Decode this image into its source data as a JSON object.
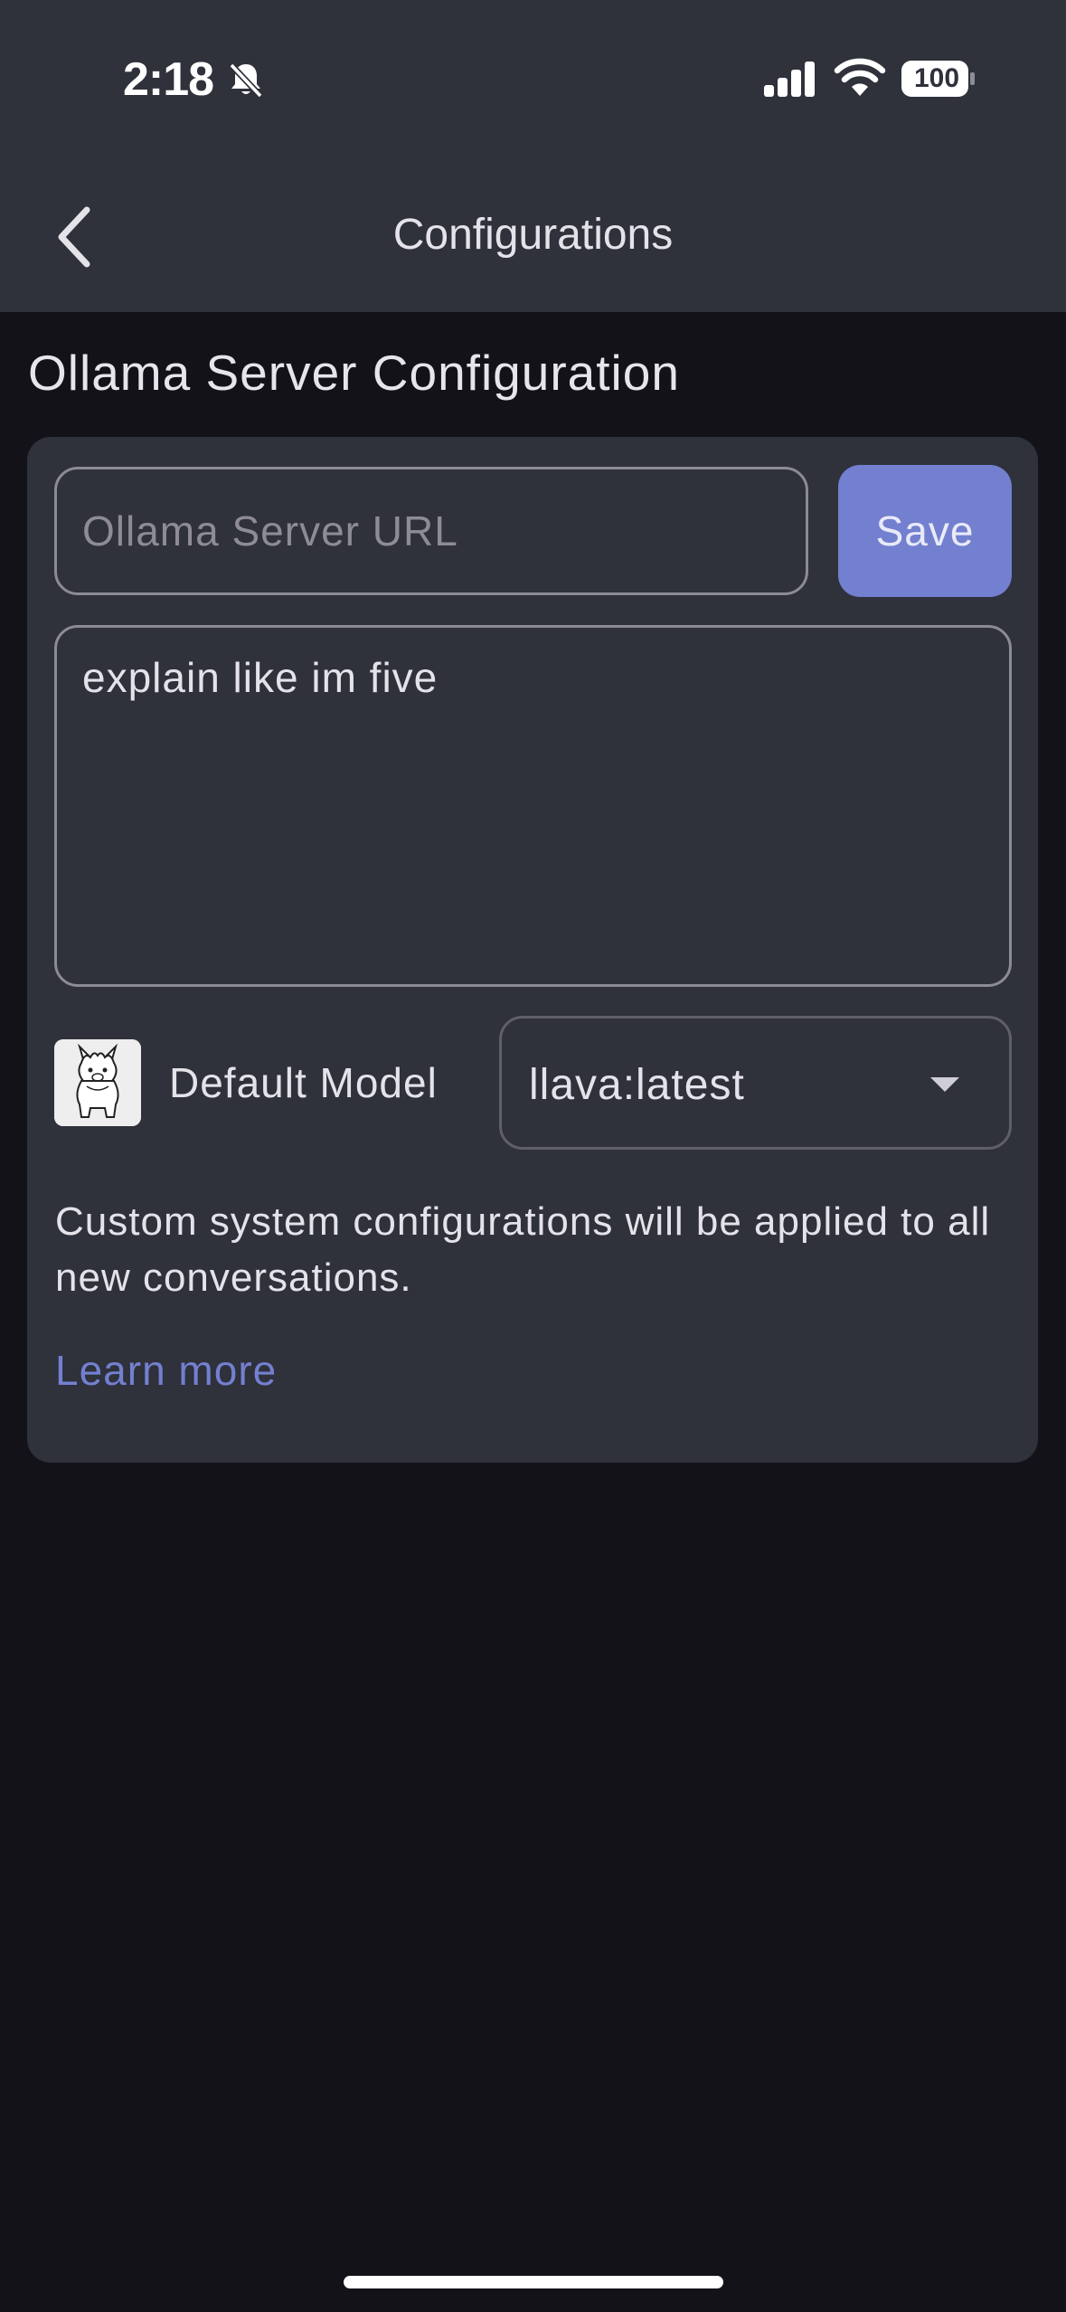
{
  "status_bar": {
    "time": "2:18",
    "battery": "100",
    "icons": [
      "bell-slash-icon",
      "cellular-signal-icon",
      "wifi-icon",
      "battery-icon"
    ]
  },
  "nav": {
    "title": "Configurations",
    "back_icon": "chevron-left-icon"
  },
  "section": {
    "title": "Ollama Server Configuration"
  },
  "server": {
    "url_value": "",
    "url_placeholder": "Ollama Server URL",
    "save_label": "Save"
  },
  "system_prompt": {
    "value": "explain like im five"
  },
  "model": {
    "label": "Default Model",
    "selected": "llava:latest",
    "avatar_icon": "llama-avatar-icon"
  },
  "info": {
    "text": "Custom system configurations will be applied to all new conversations.",
    "link": "Learn more"
  },
  "colors": {
    "background": "#131218",
    "surface": "#2f313b",
    "accent": "#7380d0",
    "text": "#e4e3ea"
  }
}
